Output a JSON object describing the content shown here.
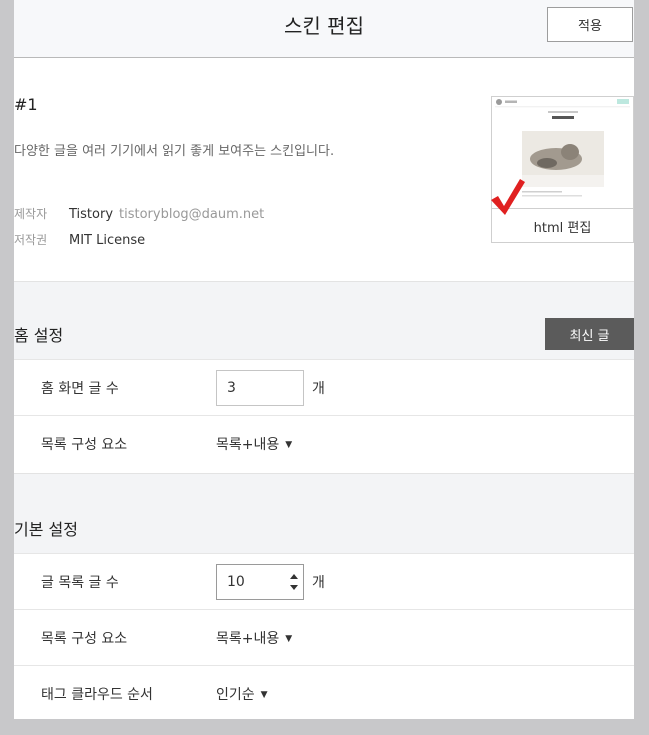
{
  "header": {
    "title": "스킨 편집",
    "apply_label": "적용"
  },
  "skin": {
    "name": "#1",
    "description": "다양한 글을 여러 기기에서 읽기 좋게 보여주는 스킨입니다.",
    "author_label": "제작자",
    "author_name": "Tistory",
    "author_email": "tistoryblog@daum.net",
    "license_label": "저작권",
    "license": "MIT License",
    "html_edit_label": "html 편집"
  },
  "home_settings": {
    "title": "홈 설정",
    "latest_button": "최신 글",
    "rows": [
      {
        "label": "홈 화면 글 수",
        "value": "3",
        "unit": "개"
      },
      {
        "label": "목록 구성 요소",
        "value": "목록+내용"
      }
    ]
  },
  "basic_settings": {
    "title": "기본 설정",
    "rows": [
      {
        "label": "글 목록 글 수",
        "value": "10",
        "unit": "개"
      },
      {
        "label": "목록 구성 요소",
        "value": "목록+내용"
      },
      {
        "label": "태그 클라우드 순서",
        "value": "인기순"
      }
    ]
  },
  "colors": {
    "accent_check": "#e02020",
    "dark_button": "#5b5b5b",
    "section_bg": "#f3f4f6"
  },
  "icons": [
    "check-mark-icon",
    "caret-down-icon",
    "spinner-arrows-icon"
  ]
}
